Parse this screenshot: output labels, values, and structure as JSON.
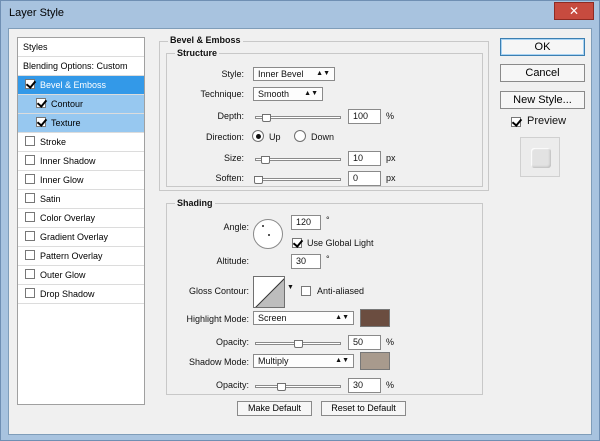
{
  "window": {
    "title": "Layer Style",
    "close_glyph": "✕"
  },
  "styles_panel": {
    "header": "Styles",
    "blending": "Blending Options: Custom",
    "items": [
      {
        "label": "Bevel & Emboss",
        "checked": true
      },
      {
        "label": "Contour",
        "checked": true
      },
      {
        "label": "Texture",
        "checked": true
      },
      {
        "label": "Stroke",
        "checked": false
      },
      {
        "label": "Inner Shadow",
        "checked": false
      },
      {
        "label": "Inner Glow",
        "checked": false
      },
      {
        "label": "Satin",
        "checked": false
      },
      {
        "label": "Color Overlay",
        "checked": false
      },
      {
        "label": "Gradient Overlay",
        "checked": false
      },
      {
        "label": "Pattern Overlay",
        "checked": false
      },
      {
        "label": "Outer Glow",
        "checked": false
      },
      {
        "label": "Drop Shadow",
        "checked": false
      }
    ]
  },
  "bevel": {
    "section_title": "Bevel & Emboss",
    "structure_title": "Structure",
    "style_label": "Style:",
    "style_value": "Inner Bevel",
    "technique_label": "Technique:",
    "technique_value": "Smooth",
    "depth_label": "Depth:",
    "depth_value": "100",
    "depth_unit": "%",
    "direction_label": "Direction:",
    "dir_up": "Up",
    "dir_down": "Down",
    "size_label": "Size:",
    "size_value": "10",
    "size_unit": "px",
    "soften_label": "Soften:",
    "soften_value": "0",
    "soften_unit": "px"
  },
  "shading": {
    "title": "Shading",
    "angle_label": "Angle:",
    "angle_value": "120",
    "angle_unit": "°",
    "global_light": "Use Global Light",
    "altitude_label": "Altitude:",
    "altitude_value": "30",
    "altitude_unit": "°",
    "gloss_label": "Gloss Contour:",
    "anti_aliased": "Anti-aliased",
    "highlight_mode_label": "Highlight Mode:",
    "highlight_mode_value": "Screen",
    "highlight_color": "#6b4d40",
    "hl_opacity_label": "Opacity:",
    "hl_opacity_value": "50",
    "hl_opacity_unit": "%",
    "shadow_mode_label": "Shadow Mode:",
    "shadow_mode_value": "Multiply",
    "shadow_color": "#a89a8d",
    "sh_opacity_label": "Opacity:",
    "sh_opacity_value": "30",
    "sh_opacity_unit": "%"
  },
  "buttons": {
    "ok": "OK",
    "cancel": "Cancel",
    "new_style": "New Style...",
    "preview": "Preview",
    "make_default": "Make Default",
    "reset_default": "Reset to Default"
  },
  "colors": {
    "selected": "#3399e8",
    "sub_selected": "#97c8f0",
    "title_bar": "#a8c3df"
  }
}
